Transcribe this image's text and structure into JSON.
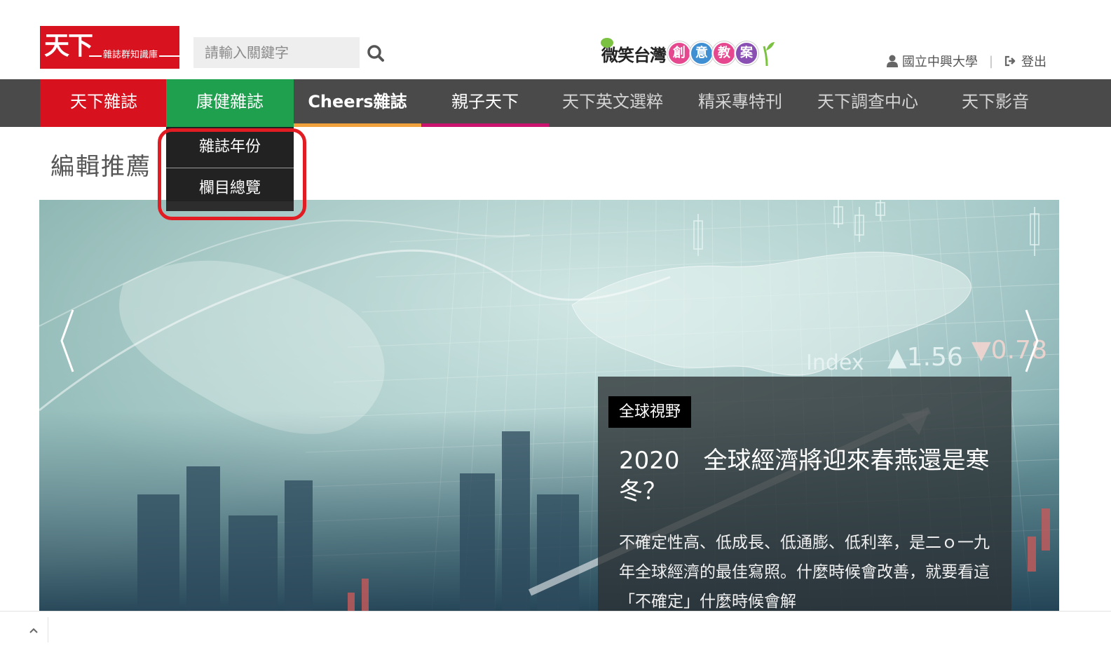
{
  "header": {
    "logo_text": "天下",
    "logo_subtext": "雜誌群知識庫",
    "search_placeholder": "請輸入關鍵字",
    "campaign_text": "微笑台灣",
    "campaign_bubbles": [
      "創",
      "意",
      "教",
      "案"
    ],
    "user_name": "國立中興大學",
    "logout_label": "登出"
  },
  "nav": {
    "items": [
      {
        "label": "天下雜誌"
      },
      {
        "label": "康健雜誌"
      },
      {
        "label": "Cheers雜誌"
      },
      {
        "label": "親子天下"
      },
      {
        "label": "天下英文選粹"
      },
      {
        "label": "精采專特刊"
      },
      {
        "label": "天下調查中心"
      },
      {
        "label": "天下影音"
      }
    ]
  },
  "dropdown": {
    "items": [
      "雜誌年份",
      "欄目總覽"
    ]
  },
  "section_title": "編輯推薦",
  "hero": {
    "overlay_labels": [
      "Index",
      "▲1.56",
      "▼0.78"
    ],
    "tag": "全球視野",
    "title": "2020　全球經濟將迎來春燕還是寒冬？",
    "body": "不確定性高、低成長、低通膨、低利率，是二ｏ一九年全球經濟的最佳寫照。什麼時候會改善，就要看這「不確定」什麼時候會解"
  },
  "colors": {
    "brand_red": "#d7121e",
    "health_green": "#1ea04e",
    "nav_bg": "#4a4a4a",
    "cheers_orange": "#f0a13c",
    "parenting_magenta": "#c9136e",
    "highlight_red": "#e11d23"
  },
  "icons": {
    "search": "search-icon",
    "user": "user-icon",
    "logout": "logout-icon",
    "prev": "chevron-left-icon",
    "next": "chevron-right-icon",
    "scroll_top": "chevron-up-icon"
  }
}
